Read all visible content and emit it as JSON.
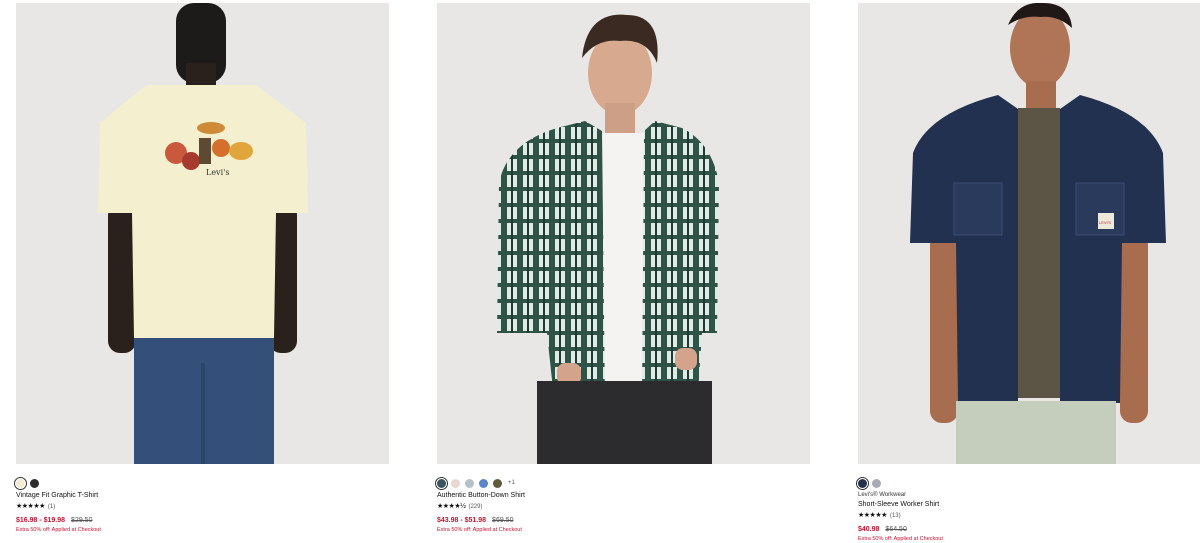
{
  "products": [
    {
      "brand": "",
      "name": "Vintage Fit Graphic T-Shirt",
      "swatches": [
        "#f3ecd6",
        "#2b2b2b"
      ],
      "more_colors": "",
      "stars": "★★★★★",
      "review_count": "(1)",
      "sale_price": "$16.98 - $19.98",
      "original_price": "$29.50",
      "promo": "Extra 50% off: Applied at Checkout",
      "graphic_text": "Levi's"
    },
    {
      "brand": "",
      "name": "Authentic Button-Down Shirt",
      "swatches": [
        "#3a5560",
        "#e8d8cf",
        "#b8bfcc",
        "#5b86c8",
        "#5f5a3e"
      ],
      "more_colors": "+1",
      "stars": "★★★★½",
      "review_count": "(229)",
      "sale_price": "$43.98 - $51.98",
      "original_price": "$69.50",
      "promo": "Extra 50% off: Applied at Checkout"
    },
    {
      "brand": "Levi's® Workwear",
      "name": "Short-Sleeve Worker Shirt",
      "swatches": [
        "#23324a",
        "#a6abb5"
      ],
      "more_colors": "",
      "stars": "★★★★★",
      "review_count": "(13)",
      "sale_price": "$40.98",
      "original_price": "$64.50",
      "promo": "Extra 50% off: Applied at Checkout",
      "patch_text": "LEVI'S"
    }
  ]
}
